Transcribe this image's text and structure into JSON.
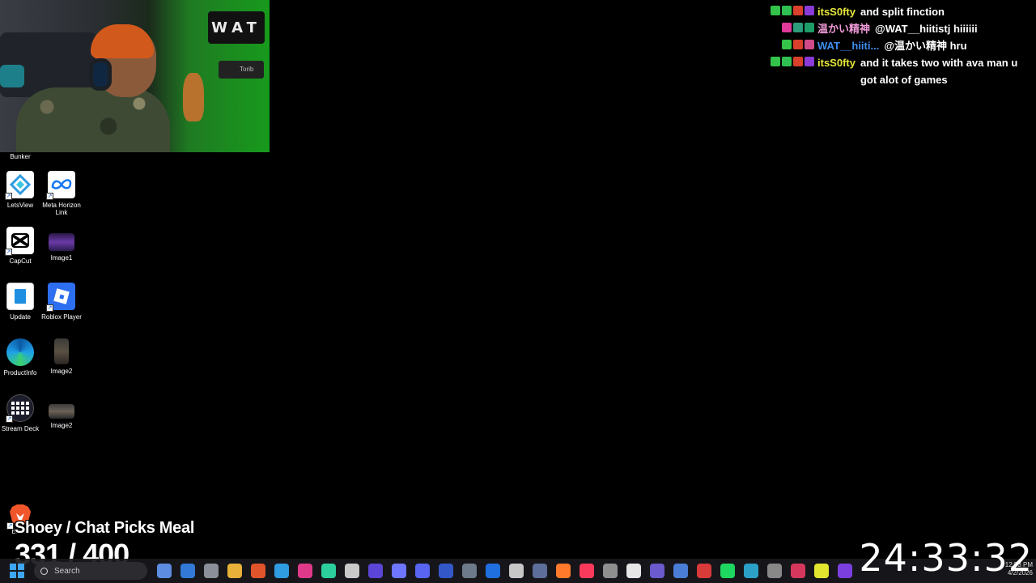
{
  "webcam": {
    "sign_text": "WAT",
    "tripod_text": "Torib"
  },
  "desktop_icons": [
    {
      "label": "Bunker"
    },
    {
      "label": "LetsView"
    },
    {
      "label": "Meta Horizon Link"
    },
    {
      "label": "CapCut"
    },
    {
      "label": "Image1"
    },
    {
      "label": "Update"
    },
    {
      "label": "Roblox Player"
    },
    {
      "label": "ProductInfo"
    },
    {
      "label": "Image2"
    },
    {
      "label": "Stream Deck"
    },
    {
      "label": "Image2"
    },
    {
      "label": "Brave"
    }
  ],
  "chat": [
    {
      "user": "itsS0fty",
      "user_color": "#e8e83a",
      "message": "and split finction",
      "badges": [
        "#35c24a",
        "#2fbf52",
        "#d9402b",
        "#8a3ad6"
      ]
    },
    {
      "user": "温かい精神",
      "user_color": "#f09ad8",
      "message": "@WAT__hiitistj hiiiiii",
      "badges": [
        "#e0399a",
        "#2c9c7a",
        "#1e9c68"
      ]
    },
    {
      "user": "WAT__hiiti...",
      "user_color": "#3d8ff0",
      "message": "@温かい精神 hru",
      "badges": [
        "#35c24a",
        "#d9402b",
        "#d04a8a"
      ]
    },
    {
      "user": "itsS0fty",
      "user_color": "#e8e83a",
      "message": "and it takes two with ava man u got alot of games",
      "badges": [
        "#35c24a",
        "#2fbf52",
        "#d9402b",
        "#8a3ad6"
      ]
    }
  ],
  "overlay": {
    "meal_title": "Shoey / Chat Picks Meal",
    "counter": "331 / 400",
    "timer": "24:33:32"
  },
  "taskbar": {
    "search_placeholder": "Search",
    "clock_time": "12:53 PM",
    "clock_date": "4/2/2026",
    "app_icons": [
      "#5c8de0",
      "#3279d8",
      "#8a8f99",
      "#e8b13a",
      "#e0542b",
      "#2f9be0",
      "#e0398a",
      "#2ccf9b",
      "#c9c9c9",
      "#5a45d6",
      "#6e76ff",
      "#5865f2",
      "#3457c8",
      "#6d7a8a",
      "#1f6fe0",
      "#c7c7c7",
      "#5e6e9a",
      "#ff7a2b",
      "#fa3a5c",
      "#8f8f8f",
      "#e6e6e6",
      "#6a5acd",
      "#4a7dd6",
      "#d93b3b",
      "#1ed760",
      "#2ba1c8",
      "#888888",
      "#d6375c",
      "#e3e62e",
      "#7b3fe0"
    ]
  }
}
